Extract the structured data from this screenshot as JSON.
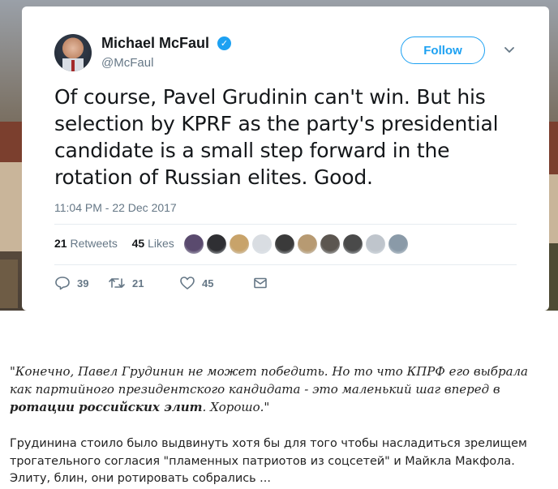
{
  "tweet": {
    "author_name": "Michael McFaul",
    "handle": "@McFaul",
    "follow_label": "Follow",
    "text": "Of course, Pavel Grudinin can't win. But his selection by KPRF as the party's presidential candidate is a small step forward in the rotation of Russian elites.  Good.",
    "timestamp": "11:04 PM - 22 Dec 2017",
    "retweets_count": "21",
    "retweets_label": "Retweets",
    "likes_count": "45",
    "likes_label": "Likes",
    "liker_avatar_colors": [
      "#5a4a6e",
      "#2f2f33",
      "#c8a36a",
      "#d9dde2",
      "#3a3a3a",
      "#b79a72",
      "#5c5650",
      "#4a4a4a",
      "#bfc5cc",
      "#8a9aa8"
    ],
    "actions": {
      "reply_count": "39",
      "retweet_count": "21",
      "like_count": "45"
    }
  },
  "article": {
    "quote_part1": "\"Конечно, Павел Грудинин не может победить. Но то что КПРФ его выбрала как партийного президентского кандидата - это маленький шаг вперед в ",
    "quote_bold": "ротации российских элит",
    "quote_part2": ". Хорошо.\"",
    "comment": "Грудинина стоило было выдвинуть хотя бы для того чтобы насладиться зрелищем трогательного согласия \"пламенных патриотов из соцсетей\" и Майкла Макфола. Элиту, блин, они ротировать собрались ..."
  },
  "colors": {
    "accent": "#1da1f2",
    "text": "#14171a",
    "secondary": "#657786"
  }
}
